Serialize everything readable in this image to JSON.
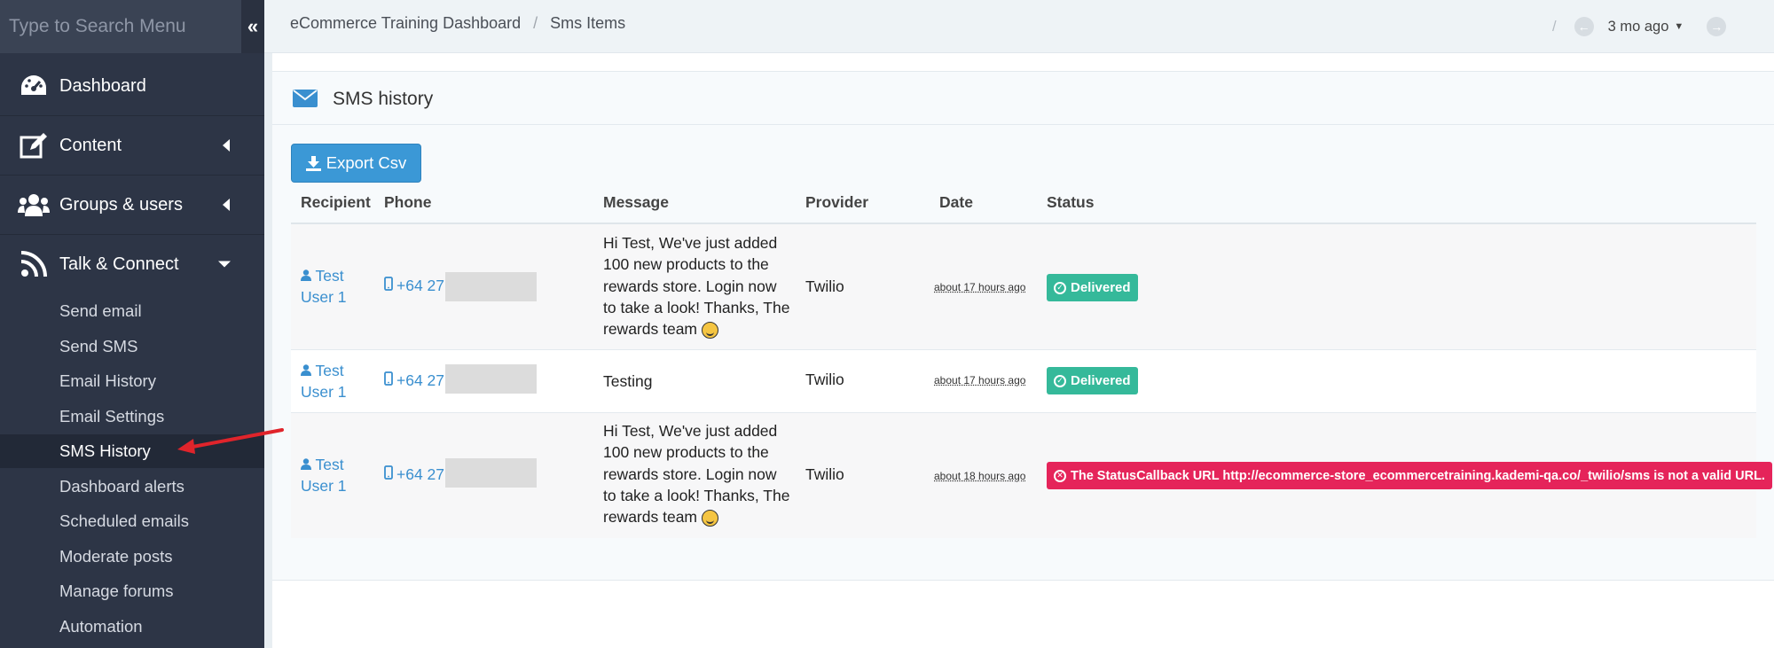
{
  "sidebar": {
    "search_placeholder": "Type to Search Menu",
    "items": [
      {
        "label": "Dashboard",
        "icon": "tachometer-icon"
      },
      {
        "label": "Content",
        "icon": "edit-icon"
      },
      {
        "label": "Groups & users",
        "icon": "users-icon"
      },
      {
        "label": "Talk & Connect",
        "icon": "rss-icon"
      }
    ],
    "sub_items": [
      {
        "label": "Send email"
      },
      {
        "label": "Send SMS"
      },
      {
        "label": "Email History"
      },
      {
        "label": "Email Settings"
      },
      {
        "label": "SMS History",
        "active": true
      },
      {
        "label": "Dashboard alerts"
      },
      {
        "label": "Scheduled emails"
      },
      {
        "label": "Moderate posts"
      },
      {
        "label": "Manage forums"
      },
      {
        "label": "Automation"
      }
    ]
  },
  "topbar": {
    "breadcrumb": [
      "eCommerce Training Dashboard",
      "Sms Items"
    ],
    "slash": "/",
    "time_label": "3 mo ago"
  },
  "panel": {
    "title": "SMS history",
    "export_label": "Export Csv"
  },
  "table": {
    "headers": [
      "Recipient",
      "Phone",
      "Message",
      "Provider",
      "Date",
      "Status"
    ],
    "rows": [
      {
        "recipient_line1": "Test",
        "recipient_line2": "User 1",
        "phone": "+64 27",
        "message_lines": [
          "Hi Test, We've just added",
          "100 new products to the",
          "rewards store. Login now",
          "to take a look! Thanks, The",
          "rewards team"
        ],
        "provider": "Twilio",
        "date": "about 17 hours ago",
        "status": "Delivered",
        "status_type": "ok"
      },
      {
        "recipient_line1": "Test",
        "recipient_line2": "User 1",
        "phone": "+64 27",
        "message_lines": [
          "Testing"
        ],
        "provider": "Twilio",
        "date": "about 17 hours ago",
        "status": "Delivered",
        "status_type": "ok"
      },
      {
        "recipient_line1": "Test",
        "recipient_line2": "User 1",
        "phone": "+64 27",
        "message_lines": [
          "Hi Test, We've just added",
          "100 new products to the",
          "rewards store. Login now",
          "to take a look! Thanks, The",
          "rewards team"
        ],
        "provider": "Twilio",
        "date": "about 18 hours ago",
        "status": "The StatusCallback URL http://ecommerce-store_ecommercetraining.kademi-qa.co/_twilio/sms is not a valid URL.",
        "status_type": "err"
      }
    ]
  },
  "colors": {
    "sidebar_bg": "#2d3546",
    "accent_blue": "#3b98d6",
    "success": "#35b99a",
    "error": "#e5245a",
    "annotation_arrow": "#e0242b"
  }
}
